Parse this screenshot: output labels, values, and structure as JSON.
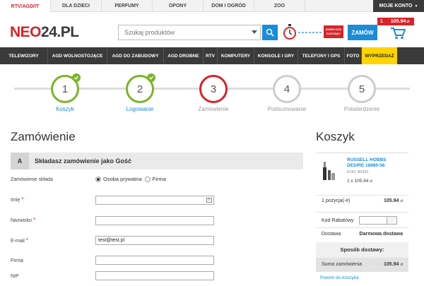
{
  "top_tabs": [
    "RTV/AGD/IT",
    "DLA DZIECI",
    "PERFUMY",
    "OPONY",
    "DOM I OGRÓD",
    "ZOO"
  ],
  "account_label": "MOJE KONTO",
  "logo": {
    "part1": "NEO",
    "part2": "24.PL"
  },
  "search": {
    "placeholder": "Szukaj produktów"
  },
  "promo_badge": "ZMIEŃ KOD DOSTAWY",
  "order_button": "ZAMÓW",
  "cart_badge": {
    "count": "1",
    "total": "105.94",
    "currency": "zł"
  },
  "nav": [
    "TELEWIZORY",
    "AGD WOLNOSTOJĄCE",
    "AGD DO ZABUDOWY",
    "AGD DROBNE",
    "RTV",
    "KOMPUTERY",
    "KONSOLE I GRY",
    "TELEFONY I GPS",
    "FOTO",
    "WYPRZEDAŻ"
  ],
  "steps": [
    {
      "num": "1",
      "label": "Koszyk",
      "state": "done"
    },
    {
      "num": "2",
      "label": "Logowanie",
      "state": "done"
    },
    {
      "num": "3",
      "label": "Zamówienie",
      "state": "current"
    },
    {
      "num": "4",
      "label": "Podsumowanie",
      "state": "todo"
    },
    {
      "num": "5",
      "label": "Potwierdzenie",
      "state": "todo"
    }
  ],
  "order": {
    "heading": "Zamówienie",
    "section_letter": "A",
    "section_title": "Składasz zamówienie jako Gość",
    "placed_by_label": "Zamówienie składa",
    "radio_private": "Osoba prywatna",
    "radio_company": "Firma",
    "fields": [
      {
        "label": "Imię",
        "required": "*",
        "value": ""
      },
      {
        "label": "Nazwisko",
        "required": "*",
        "value": ""
      },
      {
        "label": "E-mail",
        "required": "*",
        "value": "test@test.pl"
      },
      {
        "label": "Firma",
        "required": "",
        "value": ""
      },
      {
        "label": "NIP",
        "required": "",
        "value": ""
      }
    ]
  },
  "cart": {
    "heading": "Koszyk",
    "product_name": "RUSSELL HOBBS DESIRE 18980-56",
    "product_code": "KOD: 80433",
    "product_qty": "1 x 105.94",
    "positions_label": "1 pozycja(-e)",
    "positions_value": "105.94",
    "rabat_label": "Kod Rabatowy",
    "delivery_label": "Dostawa",
    "delivery_value": "Darmowa dostawa",
    "shipping_method": "Sposób dostawy:",
    "sum_label": "Suma zamówienia",
    "sum_value": "105.94",
    "currency": "zł",
    "back_link": "Powrót do koszyka"
  },
  "colors": {
    "brand_red": "#d8232a",
    "accent_blue": "#1a8cd8",
    "done_green": "#7ab527",
    "sale_yellow": "#ffd400",
    "dark_bar": "#3a3a3a"
  }
}
